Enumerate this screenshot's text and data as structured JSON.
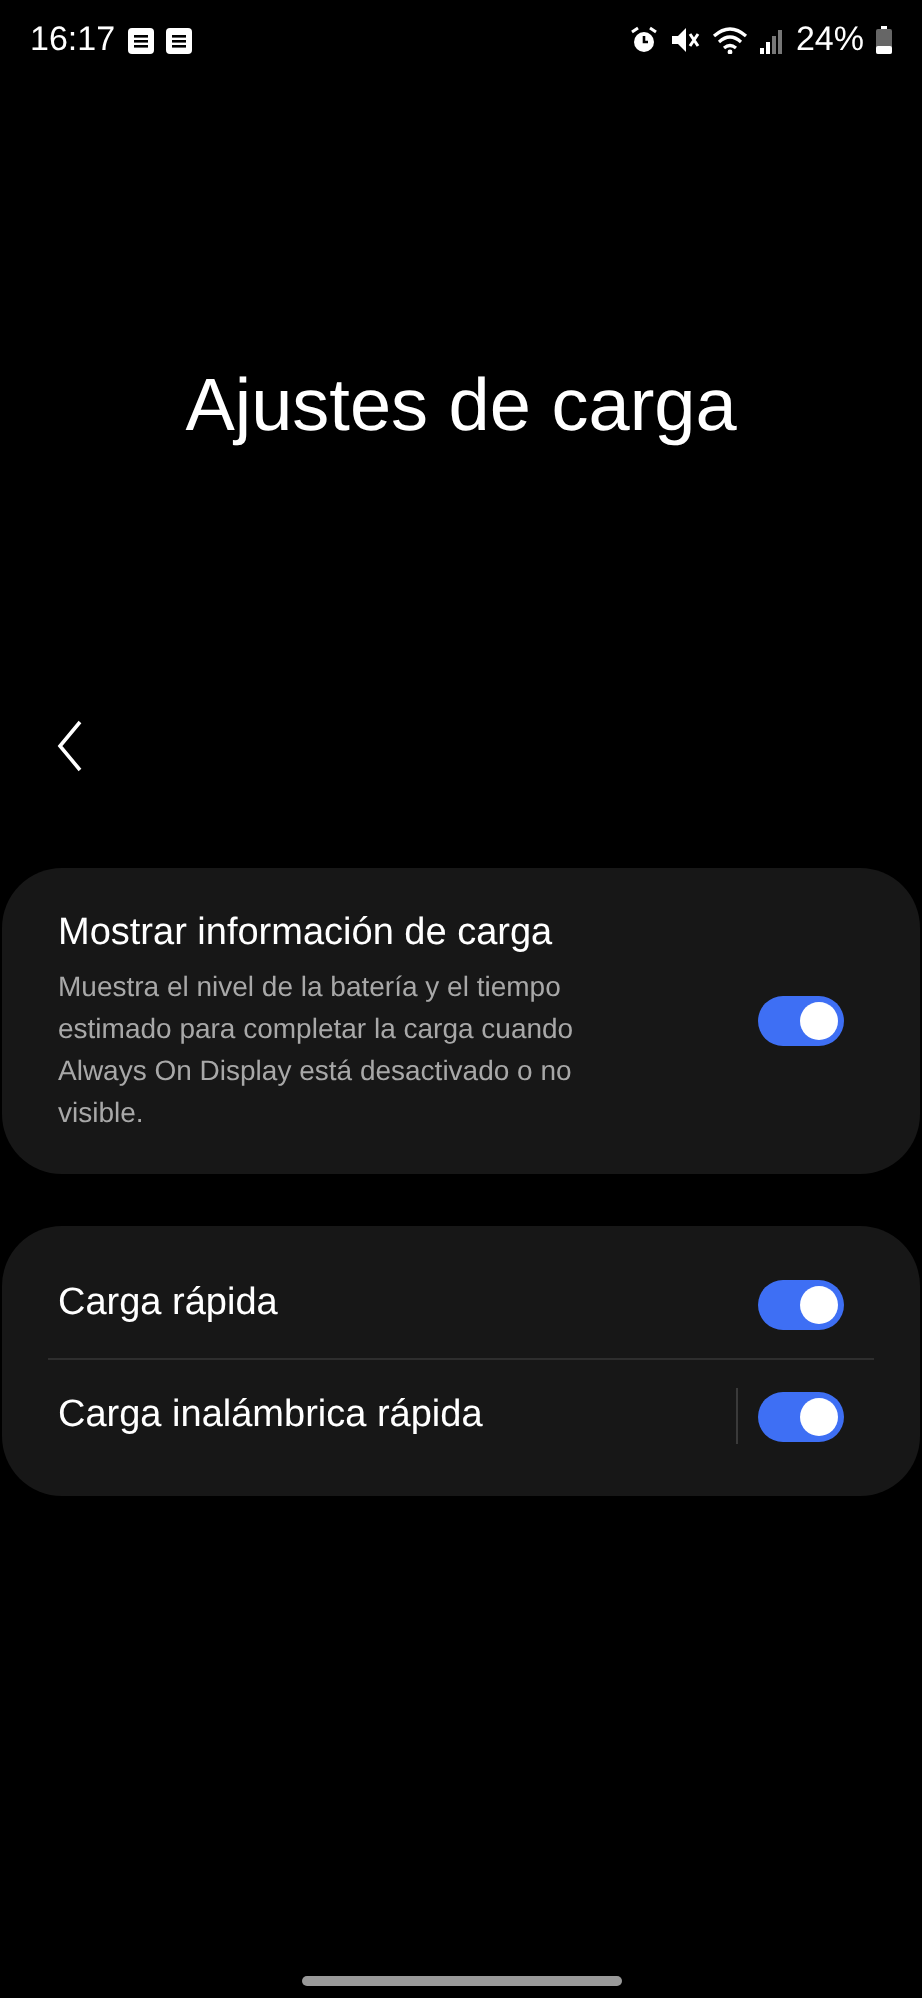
{
  "status_bar": {
    "time": "16:17",
    "battery": "24%"
  },
  "title": "Ajustes de carga",
  "groups": [
    {
      "items": [
        {
          "title": "Mostrar información de carga",
          "description": "Muestra el nivel de la batería y el tiempo estimado para completar la carga cuando Always On Display está desactivado o no visible.",
          "on": true,
          "divided": false
        }
      ]
    },
    {
      "items": [
        {
          "title": "Carga rápida",
          "on": true,
          "divided": false
        },
        {
          "title": "Carga inalámbrica rápida",
          "on": true,
          "divided": true
        }
      ]
    }
  ]
}
